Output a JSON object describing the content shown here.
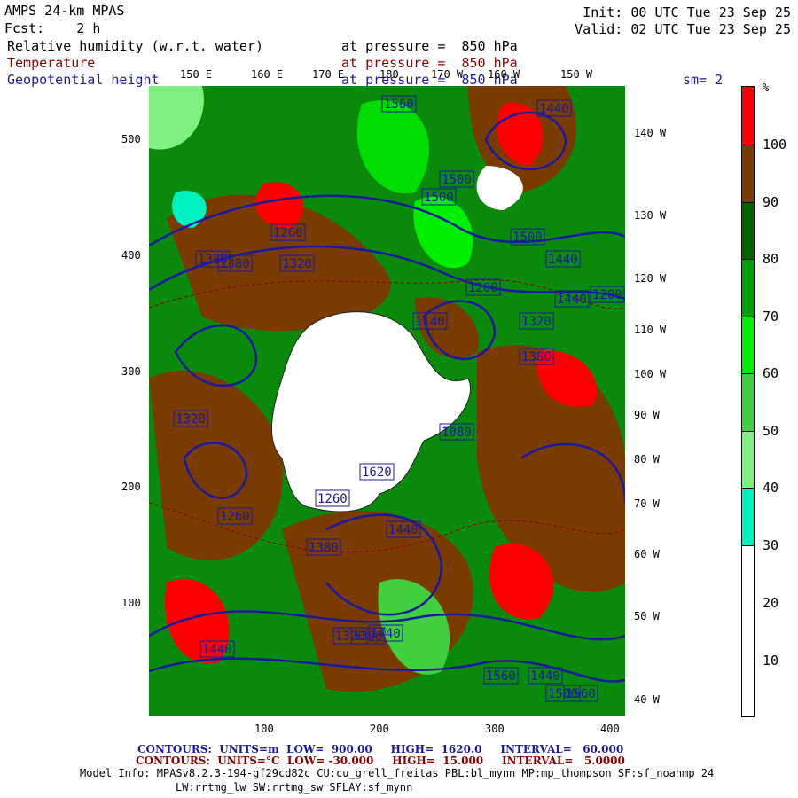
{
  "header": {
    "title": "AMPS 24-km MPAS",
    "fcst": "Fcst:    2 h",
    "init": "Init: 00 UTC Tue 23 Sep 25",
    "valid": "Valid: 02 UTC Tue 23 Sep 25",
    "fields": [
      {
        "name": "Relative humidity (w.r.t. water)",
        "level": "at pressure =  850 hPa"
      },
      {
        "name": "Temperature",
        "level": "at pressure =  850 hPa"
      },
      {
        "name": "Geopotential height",
        "level": "at pressure =  850 hPa"
      }
    ],
    "smoothing": "sm= 2"
  },
  "axes": {
    "top_lon": [
      "150 E",
      "160 E",
      "170 E",
      "180",
      "170 W",
      "160 W",
      "150 W"
    ],
    "right_lon": [
      "140 W",
      "130 W",
      "120 W",
      "110 W",
      "100 W",
      "90 W",
      "80 W",
      "70 W",
      "60 W",
      "50 W",
      "40 W"
    ],
    "left_y": [
      "500",
      "400",
      "300",
      "200",
      "100"
    ],
    "bottom_x": [
      "100",
      "200",
      "300",
      "400"
    ]
  },
  "colorbar": {
    "unit": "%",
    "labels": [
      "100",
      "90",
      "80",
      "70",
      "60",
      "50",
      "40",
      "30",
      "20",
      "10"
    ],
    "colors": [
      "#ff0000",
      "#7a3b00",
      "#006400",
      "#00a000",
      "#00ee00",
      "#3fcf3f",
      "#7fef7f",
      "#00f0c0",
      "#ffffff"
    ]
  },
  "contour_labels": [
    "1560",
    "1500",
    "1440",
    "1500",
    "1260",
    "1380",
    "1500",
    "1440",
    "1320",
    "1380",
    "1200",
    "1320",
    "1140",
    "1380",
    "1440",
    "1200",
    "1320",
    "1620",
    "1080",
    "1440",
    "1380",
    "1260",
    "1260",
    "1320",
    "1440",
    "1560",
    "1440",
    "1380",
    "1500",
    "1440",
    "1560"
  ],
  "footer": {
    "blue": {
      "label": "CONTOURS:",
      "units": "UNITS=m",
      "low": "LOW=  900.00",
      "high": "HIGH=  1620.0",
      "interval": "INTERVAL=   60.000"
    },
    "red": {
      "label": "CONTOURS:",
      "units": "UNITS=°C",
      "low": "LOW= -30.000",
      "high": "HIGH=  15.000",
      "interval": "INTERVAL=   5.0000"
    },
    "model_info": "Model Info: MPASv8.2.3-194-gf29cd82c CU:cu_grell_freitas PBL:bl_mynn MP:mp_thompson SF:sf_noahmp 24",
    "model_info2": "LW:rrtmg_lw SW:rrtmg_sw SFLAY:sf_mynn"
  }
}
